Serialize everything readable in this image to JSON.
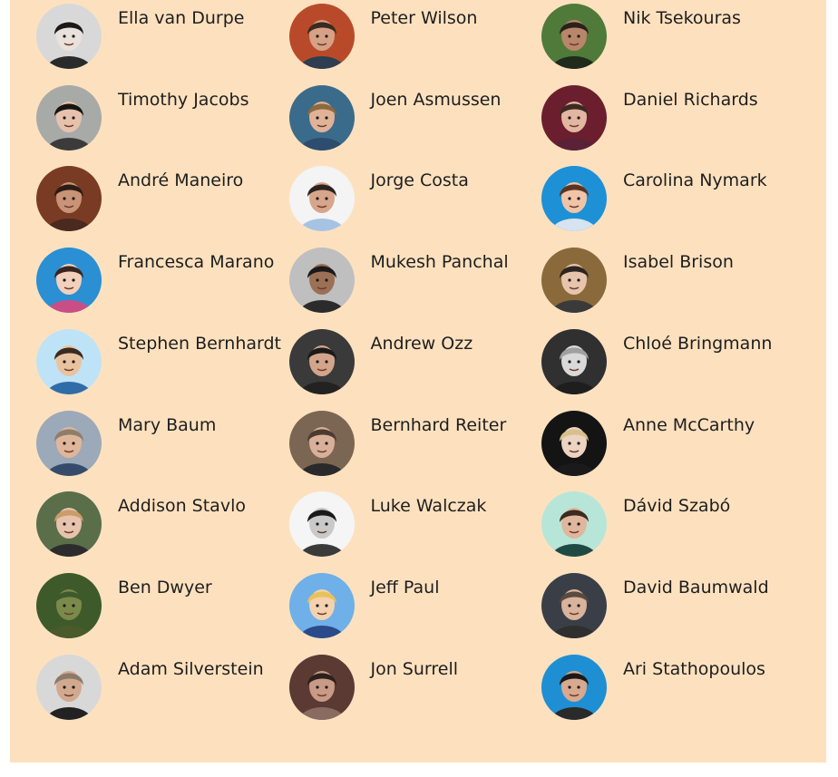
{
  "people": [
    {
      "name": "Ella van Durpe",
      "bg": "#d8d8d8",
      "skin": "#e9e2dc",
      "hair": "#1a1a1a",
      "shirt": "#2a2a2a"
    },
    {
      "name": "Peter Wilson",
      "bg": "#b84a2a",
      "skin": "#d7a185",
      "hair": "#3b2a1f",
      "shirt": "#2c3e50"
    },
    {
      "name": "Nik Tsekouras",
      "bg": "#4f7a3a",
      "skin": "#b9866a",
      "hair": "#2b211b",
      "shirt": "#1f2b1b"
    },
    {
      "name": "Timothy Jacobs",
      "bg": "#a7aaa7",
      "skin": "#e6c2ad",
      "hair": "#171512",
      "shirt": "#3b3b3b"
    },
    {
      "name": "Joen Asmussen",
      "bg": "#3b6b8a",
      "skin": "#e0b298",
      "hair": "#8b6a3e",
      "shirt": "#2d4c6e"
    },
    {
      "name": "Daniel Richards",
      "bg": "#6b1f2e",
      "skin": "#e2b6a1",
      "hair": "#3a2a22",
      "shirt": "#5a2236"
    },
    {
      "name": "André Maneiro",
      "bg": "#7a3b25",
      "skin": "#c99377",
      "hair": "#2b1c16",
      "shirt": "#4a2a1f"
    },
    {
      "name": "Jorge Costa",
      "bg": "#f4f4f4",
      "skin": "#d7a58b",
      "hair": "#2a2320",
      "shirt": "#a7c3e3"
    },
    {
      "name": "Carolina Nymark",
      "bg": "#1e90d6",
      "skin": "#f0c4a8",
      "hair": "#5a3420",
      "shirt": "#d7e3ee"
    },
    {
      "name": "Francesca Marano",
      "bg": "#2a8fd3",
      "skin": "#f2d0bb",
      "hair": "#3a2420",
      "shirt": "#c94e86"
    },
    {
      "name": "Mukesh Panchal",
      "bg": "#bfbfbf",
      "skin": "#9c7055",
      "hair": "#1a1a1a",
      "shirt": "#2b2b2b"
    },
    {
      "name": "Isabel Brison",
      "bg": "#8a6a3a",
      "skin": "#e8c4ad",
      "hair": "#2b2420",
      "shirt": "#3a3a3a"
    },
    {
      "name": "Stephen Bernhardt",
      "bg": "#bfe3f6",
      "skin": "#e9c3a0",
      "hair": "#3a2a1f",
      "shirt": "#2f6ca8"
    },
    {
      "name": "Andrew Ozz",
      "bg": "#3a3a3a",
      "skin": "#d2a58a",
      "hair": "#1a1a1a",
      "shirt": "#222222"
    },
    {
      "name": "Chloé Bringmann",
      "bg": "#303030",
      "skin": "#d9d9d9",
      "hair": "#a0a0a0",
      "shirt": "#1e1e1e"
    },
    {
      "name": "Mary Baum",
      "bg": "#9ca9b9",
      "skin": "#e0b69a",
      "hair": "#8e7d6a",
      "shirt": "#364b6b"
    },
    {
      "name": "Bernhard Reiter",
      "bg": "#7b6653",
      "skin": "#d8b09a",
      "hair": "#4b3a30",
      "shirt": "#2a2a2a"
    },
    {
      "name": "Anne McCarthy",
      "bg": "#141414",
      "skin": "#ecd3c2",
      "hair": "#d8c08d",
      "shirt": "#1a1a1a"
    },
    {
      "name": "Addison Stavlo",
      "bg": "#5a6e4a",
      "skin": "#e7c3ad",
      "hair": "#c99c6a",
      "shirt": "#2c2c2c"
    },
    {
      "name": "Luke Walczak",
      "bg": "#f5f5f5",
      "skin": "#c9c9c9",
      "hair": "#1a1a1a",
      "shirt": "#3a3a3a"
    },
    {
      "name": "Dávid Szabó",
      "bg": "#b7e6d8",
      "skin": "#e0b69c",
      "hair": "#3b2a1f",
      "shirt": "#1f4a44"
    },
    {
      "name": "Ben Dwyer",
      "bg": "#3f5a2a",
      "skin": "#7a8a4a",
      "hair": "#3f5a2a",
      "shirt": "#4a5a2a"
    },
    {
      "name": "Jeff Paul",
      "bg": "#6fb0e8",
      "skin": "#f4d2b0",
      "hair": "#e8c25a",
      "shirt": "#2a4a8a"
    },
    {
      "name": "David Baumwald",
      "bg": "#3a3f47",
      "skin": "#d9b39c",
      "hair": "#5a4a40",
      "shirt": "#2f2f2f"
    },
    {
      "name": "Adam Silverstein",
      "bg": "#d8d8d8",
      "skin": "#d2a98f",
      "hair": "#8a7a6a",
      "shirt": "#222222"
    },
    {
      "name": "Jon Surrell",
      "bg": "#5a3a33",
      "skin": "#c99a86",
      "hair": "#2b201c",
      "shirt": "#8a6b62"
    },
    {
      "name": "Ari Stathopoulos",
      "bg": "#1e8fd3",
      "skin": "#d8a98e",
      "hair": "#1a1a1a",
      "shirt": "#2a2a2a"
    }
  ]
}
